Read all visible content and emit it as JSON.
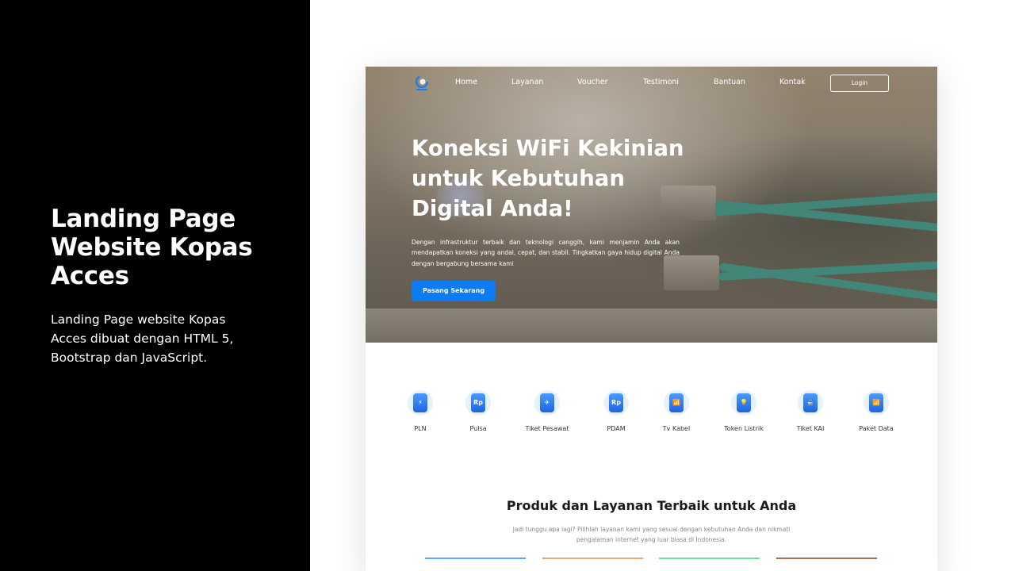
{
  "left": {
    "title": "Landing Page Website Kopas Acces",
    "description": "Landing Page website Kopas Acces dibuat dengan HTML 5, Bootstrap dan JavaScript."
  },
  "nav": {
    "links": [
      "Home",
      "Layanan",
      "Voucher",
      "Testimoni",
      "Bantuan",
      "Kontak"
    ],
    "login_label": "Login"
  },
  "hero": {
    "title": "Koneksi WiFi Kekinian untuk Kebutuhan Digital Anda!",
    "description": "Dengan infrastruktur terbaik dan teknologi canggih, kami menjamin Anda akan mendapatkan koneksi yang andal, cepat, dan stabil. Tingkatkan gaya hidup digital Anda dengan bergabung bersama kami",
    "cta_label": "Pasang Sekarang"
  },
  "services": [
    {
      "label": "PLN",
      "icon": "lightning-icon",
      "glyph": "⚡"
    },
    {
      "label": "Pulsa",
      "icon": "phone-credit-icon",
      "glyph": "Rp"
    },
    {
      "label": "Tiket Pesawat",
      "icon": "plane-icon",
      "glyph": "✈"
    },
    {
      "label": "PDAM",
      "icon": "water-drop-icon",
      "glyph": "Rp"
    },
    {
      "label": "Tv Kabel",
      "icon": "tv-icon",
      "glyph": "📶"
    },
    {
      "label": "Token Listrik",
      "icon": "bulb-icon",
      "glyph": "💡"
    },
    {
      "label": "Tiket KAI",
      "icon": "train-icon",
      "glyph": "🚆"
    },
    {
      "label": "Paket Data",
      "icon": "wifi-phone-icon",
      "glyph": "📶"
    }
  ],
  "section": {
    "title": "Produk dan Layanan Terbaik untuk Anda",
    "description": "Jadi tunggu apa lagi? Pilihlah layanan kami yang sesuai dengan kebutuhan Anda dan nikmati pengalaman internet yang luar biasa di Indonesia."
  },
  "colors": {
    "accent": "#0d7cf2",
    "card_lines": [
      "#5aa7ff",
      "#f0a574",
      "#6be29a",
      "#a86e4e"
    ]
  }
}
